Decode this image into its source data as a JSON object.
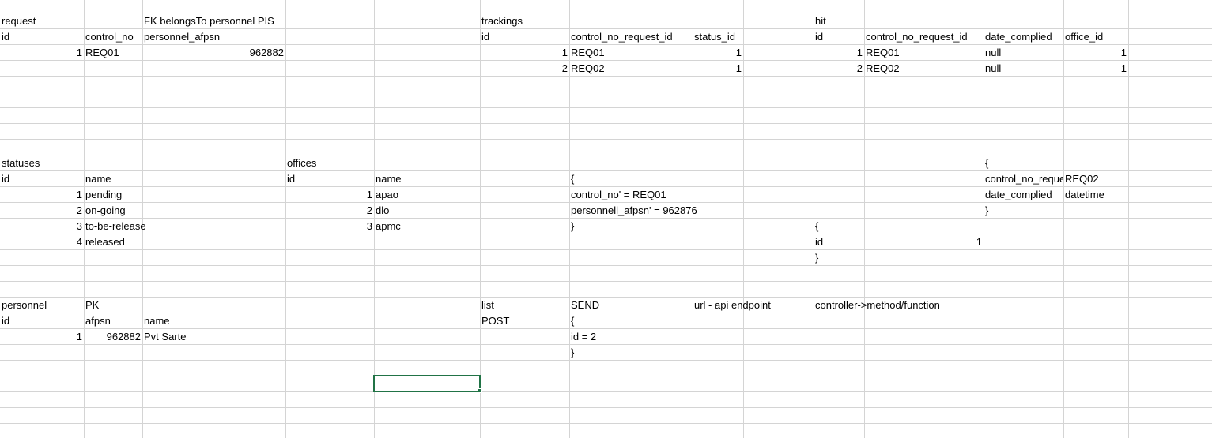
{
  "sheet": {
    "cells": [
      {
        "id": "a1",
        "text": "request"
      },
      {
        "id": "c1",
        "text": "FK belongsTo personnel PIS"
      },
      {
        "id": "g1",
        "text": "trackings"
      },
      {
        "id": "j1",
        "text": "hit"
      },
      {
        "id": "a2",
        "text": "id"
      },
      {
        "id": "b2",
        "text": "control_no"
      },
      {
        "id": "c2",
        "text": "personnel_afpsn"
      },
      {
        "id": "g2",
        "text": "id"
      },
      {
        "id": "h2",
        "text": "control_no_request_id"
      },
      {
        "id": "i2",
        "text": "status_id"
      },
      {
        "id": "j2",
        "text": "id"
      },
      {
        "id": "k2",
        "text": "control_no_request_id"
      },
      {
        "id": "l2",
        "text": "date_complied"
      },
      {
        "id": "m2",
        "text": "office_id"
      },
      {
        "id": "a3",
        "text": "1"
      },
      {
        "id": "b3",
        "text": "REQ01"
      },
      {
        "id": "c3",
        "text": "962882"
      },
      {
        "id": "g3",
        "text": "1"
      },
      {
        "id": "h3",
        "text": "REQ01"
      },
      {
        "id": "i3",
        "text": "1"
      },
      {
        "id": "j3",
        "text": "1"
      },
      {
        "id": "k3",
        "text": "REQ01"
      },
      {
        "id": "l3",
        "text": "null"
      },
      {
        "id": "m3",
        "text": "1"
      },
      {
        "id": "g4",
        "text": "2"
      },
      {
        "id": "h4",
        "text": "REQ02"
      },
      {
        "id": "i4",
        "text": "1"
      },
      {
        "id": "j4",
        "text": "2"
      },
      {
        "id": "k4",
        "text": "REQ02"
      },
      {
        "id": "l4",
        "text": "null"
      },
      {
        "id": "m4",
        "text": "1"
      },
      {
        "id": "a10",
        "text": "statuses"
      },
      {
        "id": "d10",
        "text": "offices"
      },
      {
        "id": "l10",
        "text": "{"
      },
      {
        "id": "a11",
        "text": "id"
      },
      {
        "id": "b11",
        "text": "name"
      },
      {
        "id": "d11",
        "text": "id"
      },
      {
        "id": "e11",
        "text": "name"
      },
      {
        "id": "h11",
        "text": "{"
      },
      {
        "id": "l11",
        "text": "control_no_request_id"
      },
      {
        "id": "m11",
        "text": "REQ02"
      },
      {
        "id": "a12",
        "text": "1"
      },
      {
        "id": "b12",
        "text": "pending"
      },
      {
        "id": "d12",
        "text": "1"
      },
      {
        "id": "e12",
        "text": "apao"
      },
      {
        "id": "h12",
        "text": "control_no' = REQ01"
      },
      {
        "id": "l12",
        "text": "date_complied"
      },
      {
        "id": "m12",
        "text": "datetime"
      },
      {
        "id": "a13",
        "text": "2"
      },
      {
        "id": "b13",
        "text": "on-going"
      },
      {
        "id": "d13",
        "text": "2"
      },
      {
        "id": "e13",
        "text": "dlo"
      },
      {
        "id": "h13",
        "text": "personnell_afpsn' = 962876"
      },
      {
        "id": "l13",
        "text": "}"
      },
      {
        "id": "a14",
        "text": "3"
      },
      {
        "id": "b14",
        "text": "to-be-release"
      },
      {
        "id": "d14",
        "text": "3"
      },
      {
        "id": "e14",
        "text": "apmc"
      },
      {
        "id": "h14",
        "text": "}"
      },
      {
        "id": "j14",
        "text": "{"
      },
      {
        "id": "a15",
        "text": "4"
      },
      {
        "id": "b15",
        "text": "released"
      },
      {
        "id": "j15",
        "text": "id"
      },
      {
        "id": "k15",
        "text": "1"
      },
      {
        "id": "j16",
        "text": "}"
      },
      {
        "id": "a19",
        "text": "personnel"
      },
      {
        "id": "b19",
        "text": "PK"
      },
      {
        "id": "g19",
        "text": "list"
      },
      {
        "id": "h19",
        "text": "SEND"
      },
      {
        "id": "i19",
        "text": "url - api endpoint"
      },
      {
        "id": "j19",
        "text": "controller->method/function"
      },
      {
        "id": "a20",
        "text": "id"
      },
      {
        "id": "b20",
        "text": "afpsn"
      },
      {
        "id": "c20",
        "text": "name"
      },
      {
        "id": "g20",
        "text": "POST"
      },
      {
        "id": "h20",
        "text": "{"
      },
      {
        "id": "a21",
        "text": "1"
      },
      {
        "id": "b21",
        "text": "962882"
      },
      {
        "id": "c21",
        "text": "Pvt Sarte"
      },
      {
        "id": "h21",
        "text": "id = 2"
      },
      {
        "id": "h22",
        "text": "}"
      }
    ]
  }
}
